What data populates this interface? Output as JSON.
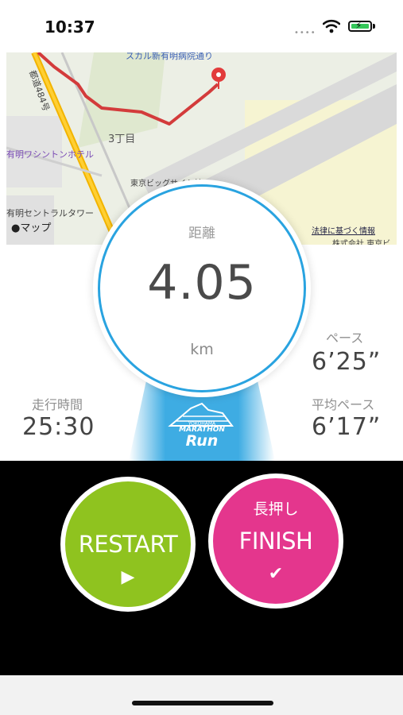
{
  "status": {
    "time": "10:37",
    "signal": "••••"
  },
  "map": {
    "labels": {
      "top_street": "スカル新有明病院通り",
      "road_vertical": "都道484号",
      "district": "3丁目",
      "hotel": "有明ワシントンホテル",
      "station": "東京ビッグサイト前",
      "tower": "有明セントラルタワー",
      "company": "株式会社 東京ビ"
    },
    "attribution": "マップ",
    "legal": "法律に基づく情報"
  },
  "distance": {
    "label": "距離",
    "value": "4.05",
    "unit": "km"
  },
  "pace": {
    "label": "ペース",
    "value": "6’25”"
  },
  "avg_pace": {
    "label": "平均ペース",
    "value": "6’17”"
  },
  "elapsed": {
    "label": "走行時間",
    "value": "25:30"
  },
  "brand": {
    "line1": "YOKOHAMA",
    "line2": "MARATHON",
    "run": "Run"
  },
  "buttons": {
    "restart": {
      "label": "RESTART",
      "icon": "▶"
    },
    "finish": {
      "sub": "長押し",
      "label": "FINISH",
      "icon": "✔"
    }
  },
  "colors": {
    "accent_blue": "#29a3e0",
    "restart_green": "#8fc31f",
    "finish_pink": "#e4368d"
  }
}
